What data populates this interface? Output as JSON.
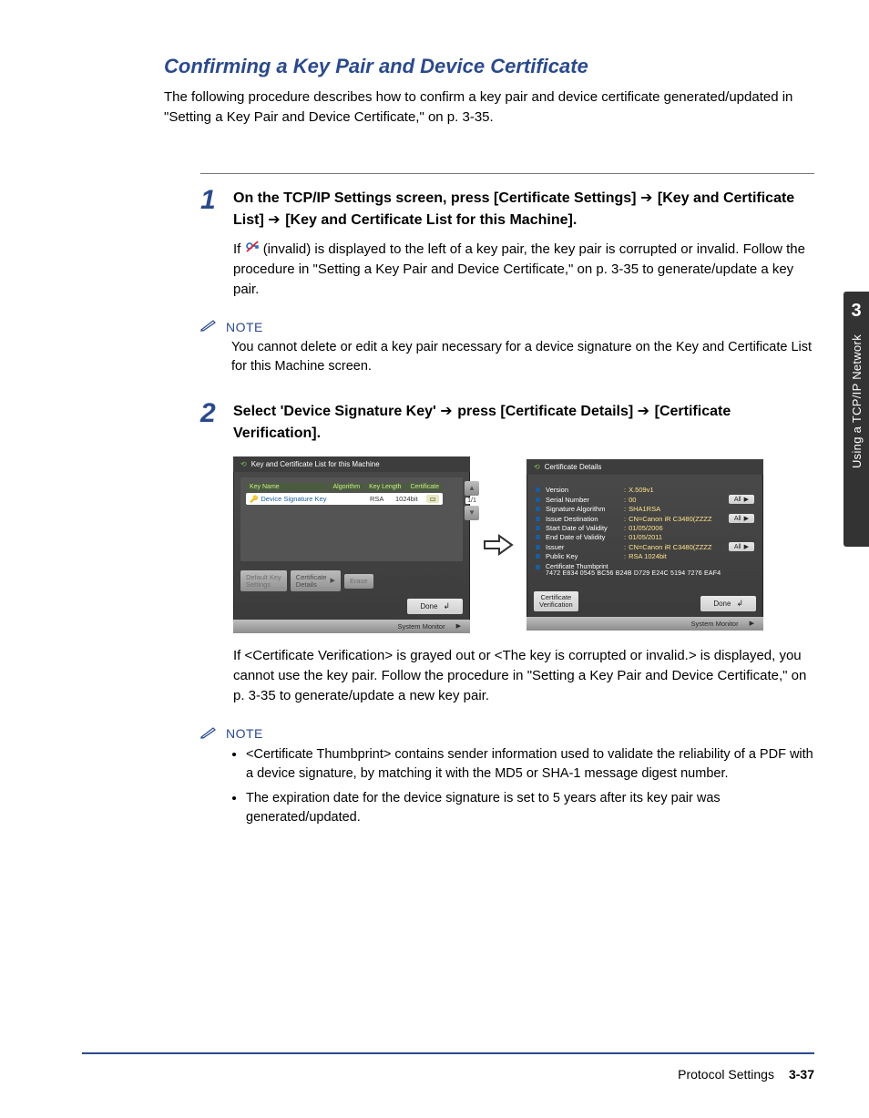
{
  "sideTab": {
    "chapter": "3",
    "text": "Using a TCP/IP Network"
  },
  "title": "Confirming a Key Pair and Device Certificate",
  "intro": "The following procedure describes how to confirm a key pair and device certificate generated/updated in \"Setting a Key Pair and Device Certificate,\" on p. 3-35.",
  "step1": {
    "num": "1",
    "titleA": "On the TCP/IP Settings screen, press [Certificate Settings] ",
    "titleB": "[Key and Certificate List] ",
    "titleC": "[Key and Certificate List for this Machine].",
    "bodyA": "If ",
    "bodyB": " (invalid) is displayed to the left of a key pair, the key pair is corrupted or invalid. Follow the procedure in \"Setting a Key Pair and Device Certificate,\" on p. 3-35 to generate/update a key pair."
  },
  "note1": {
    "label": "NOTE",
    "text": "You cannot delete or edit a key pair necessary for a device signature on the Key and Certificate List for this Machine screen."
  },
  "step2": {
    "num": "2",
    "titleA": "Select 'Device Signature Key' ",
    "titleB": "press [Certificate Details] ",
    "titleC": "[Certificate Verification].",
    "after": "If <Certificate Verification> is grayed out or <The key is corrupted or invalid.> is displayed, you cannot use the key pair. Follow the procedure in \"Setting a Key Pair and Device Certificate,\" on p. 3-35 to generate/update a new key pair."
  },
  "note2": {
    "label": "NOTE",
    "items": [
      "<Certificate Thumbprint> contains sender information used to validate the reliability of a PDF with a device signature, by matching it with the MD5 or SHA-1 message digest number.",
      "The expiration date for the device signature is set to 5 years after its key pair was generated/updated."
    ]
  },
  "shotLeft": {
    "title": "Key and Certificate List for this Machine",
    "headers": {
      "keyName": "Key Name",
      "algorithm": "Algorithm",
      "keyLength": "Key Length",
      "certificate": "Certificate"
    },
    "row": {
      "keyName": "Device Signature Key",
      "algorithm": "RSA",
      "keyLength": "1024bit",
      "certIcon": "📄"
    },
    "pageIndicator": "1/1",
    "buttons": {
      "defaultKey": "Default Key\nSettings",
      "certDetails": "Certificate\nDetails",
      "erase": "Erase",
      "done": "Done"
    },
    "sysMonitor": "System Monitor"
  },
  "shotRight": {
    "title": "Certificate Details",
    "rows": {
      "version": {
        "label": "Version",
        "value": "X.509v1"
      },
      "serial": {
        "label": "Serial Number",
        "value": "00",
        "all": true
      },
      "sigAlg": {
        "label": "Signature Algorithm",
        "value": "SHA1RSA"
      },
      "issueDest": {
        "label": "Issue Destination",
        "value": "CN=Canon iR C3480(ZZZZ",
        "all": true
      },
      "startValidity": {
        "label": "Start Date of Validity",
        "value": "01/05/2006"
      },
      "endValidity": {
        "label": "End Date of Validity",
        "value": "01/05/2011"
      },
      "issuer": {
        "label": "Issuer",
        "value": "CN=Canon iR C3480(ZZZZ",
        "all": true
      },
      "publicKey": {
        "label": "Public Key",
        "value": "RSA  1024bit"
      }
    },
    "thumbLabel": "Certificate Thumbprint",
    "thumbValue": "7472 E834 0545 BC56 B24B D729 E24C 5194 7276 EAF4",
    "allLabel": "All",
    "buttons": {
      "certVerify": "Certificate\nVerification",
      "done": "Done"
    },
    "sysMonitor": "System Monitor"
  },
  "footer": {
    "section": "Protocol Settings",
    "page": "3-37"
  }
}
